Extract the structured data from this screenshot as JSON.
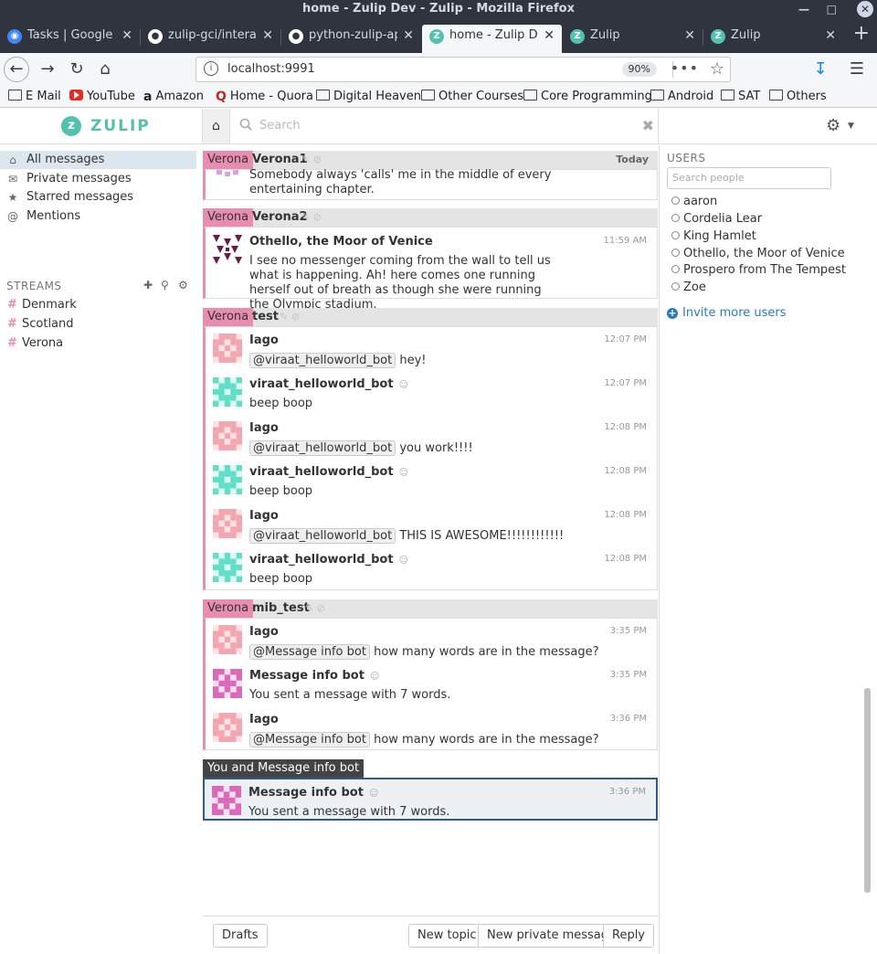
{
  "window": {
    "title": "home - Zulip Dev - Zulip - Mozilla Firefox"
  },
  "tabs": [
    {
      "label": "Tasks | Google C",
      "icon": "google-tasks-icon",
      "active": false
    },
    {
      "label": "zulip-gci/interact",
      "icon": "github-icon",
      "active": false
    },
    {
      "label": "python-zulip-api/",
      "icon": "github-icon",
      "active": false
    },
    {
      "label": "home - Zulip Dev",
      "icon": "zulip-icon",
      "active": true
    },
    {
      "label": "Zulip",
      "icon": "zulip-icon",
      "active": false
    },
    {
      "label": "Zulip",
      "icon": "zulip-icon",
      "active": false
    }
  ],
  "navbar": {
    "url": "localhost:9991",
    "zoom": "90%"
  },
  "bookmarks": [
    {
      "label": "E Mail",
      "icon": "folder-icon"
    },
    {
      "label": "YouTube",
      "icon": "youtube-icon"
    },
    {
      "label": "Amazon",
      "icon": "amazon-icon"
    },
    {
      "label": "Home - Quora",
      "icon": "quora-icon"
    },
    {
      "label": "Digital Heaven",
      "icon": "folder-icon"
    },
    {
      "label": "Other Courses",
      "icon": "folder-icon"
    },
    {
      "label": "Core Programming",
      "icon": "folder-icon"
    },
    {
      "label": "Android",
      "icon": "folder-icon"
    },
    {
      "label": "SAT",
      "icon": "folder-icon"
    },
    {
      "label": "Others",
      "icon": "folder-icon"
    }
  ],
  "app": {
    "logo_text": "ZULIP",
    "search_placeholder": "Search",
    "colors": {
      "accent": "#52c2af",
      "stream_verona": "#e88db0",
      "link": "#2a7ac0",
      "active_nav": "#dce6ef"
    }
  },
  "leftbar": {
    "nav": [
      {
        "label": "All messages",
        "icon": "home-icon",
        "active": true
      },
      {
        "label": "Private messages",
        "icon": "envelope-icon",
        "active": false
      },
      {
        "label": "Starred messages",
        "icon": "star-icon",
        "active": false
      },
      {
        "label": "Mentions",
        "icon": "at-icon",
        "active": false
      }
    ],
    "streams_header": "STREAMS",
    "streams": [
      {
        "name": "Denmark"
      },
      {
        "name": "Scotland"
      },
      {
        "name": "Verona"
      }
    ]
  },
  "messages": {
    "groups": [
      {
        "stream": "Verona",
        "topic": "Verona1",
        "date": "Today",
        "messages": [
          {
            "content": "Somebody always 'calls' me in the middle of every entertaining chapter."
          }
        ]
      },
      {
        "stream": "Verona",
        "topic": "Verona2",
        "messages": [
          {
            "sender": "Othello, the Moor of Venice",
            "time": "11:59 AM",
            "content": "I see no messenger coming from the wall to tell us what is happening. Ah! here comes one running herself out of breath as though she were running the Olympic stadium."
          }
        ]
      },
      {
        "stream": "Verona",
        "topic": "test",
        "messages": [
          {
            "sender": "Iago",
            "time": "12:07 PM",
            "mention": "@viraat_helloworld_bot",
            "content": "hey!"
          },
          {
            "sender": "viraat_helloworld_bot",
            "time": "12:07 PM",
            "content": "beep boop",
            "bot": true
          },
          {
            "sender": "Iago",
            "time": "12:08 PM",
            "mention": "@viraat_helloworld_bot",
            "content": "you work!!!!"
          },
          {
            "sender": "viraat_helloworld_bot",
            "time": "12:08 PM",
            "content": "beep boop",
            "bot": true
          },
          {
            "sender": "Iago",
            "time": "12:08 PM",
            "mention": "@viraat_helloworld_bot",
            "content": "THIS IS AWESOME!!!!!!!!!!!!"
          },
          {
            "sender": "viraat_helloworld_bot",
            "time": "12:08 PM",
            "content": "beep boop",
            "bot": true
          }
        ]
      },
      {
        "stream": "Verona",
        "topic": "mib_test",
        "messages": [
          {
            "sender": "Iago",
            "time": "3:35 PM",
            "mention": "@Message info bot",
            "content": "how many words are in the message?"
          },
          {
            "sender": "Message info bot",
            "time": "3:35 PM",
            "content": "You sent a message with 7 words.",
            "bot": true
          },
          {
            "sender": "Iago",
            "time": "3:36 PM",
            "mention": "@Message info bot",
            "content": "how many words are in the message?"
          }
        ]
      },
      {
        "pm_label": "You and Message info bot",
        "messages": [
          {
            "sender": "Message info bot",
            "time": "3:36 PM",
            "content": "You sent a message with 7 words.",
            "bot": true
          }
        ]
      }
    ]
  },
  "compose": {
    "drafts": "Drafts",
    "new_topic": "New topic",
    "new_pm": "New private message",
    "reply": "Reply"
  },
  "rightbar": {
    "users_header": "USERS",
    "search_placeholder": "Search people",
    "users": [
      "aaron",
      "Cordelia Lear",
      "King Hamlet",
      "Othello, the Moor of Venice",
      "Prospero from The Tempest",
      "Zoe"
    ],
    "invite": "Invite more users"
  }
}
